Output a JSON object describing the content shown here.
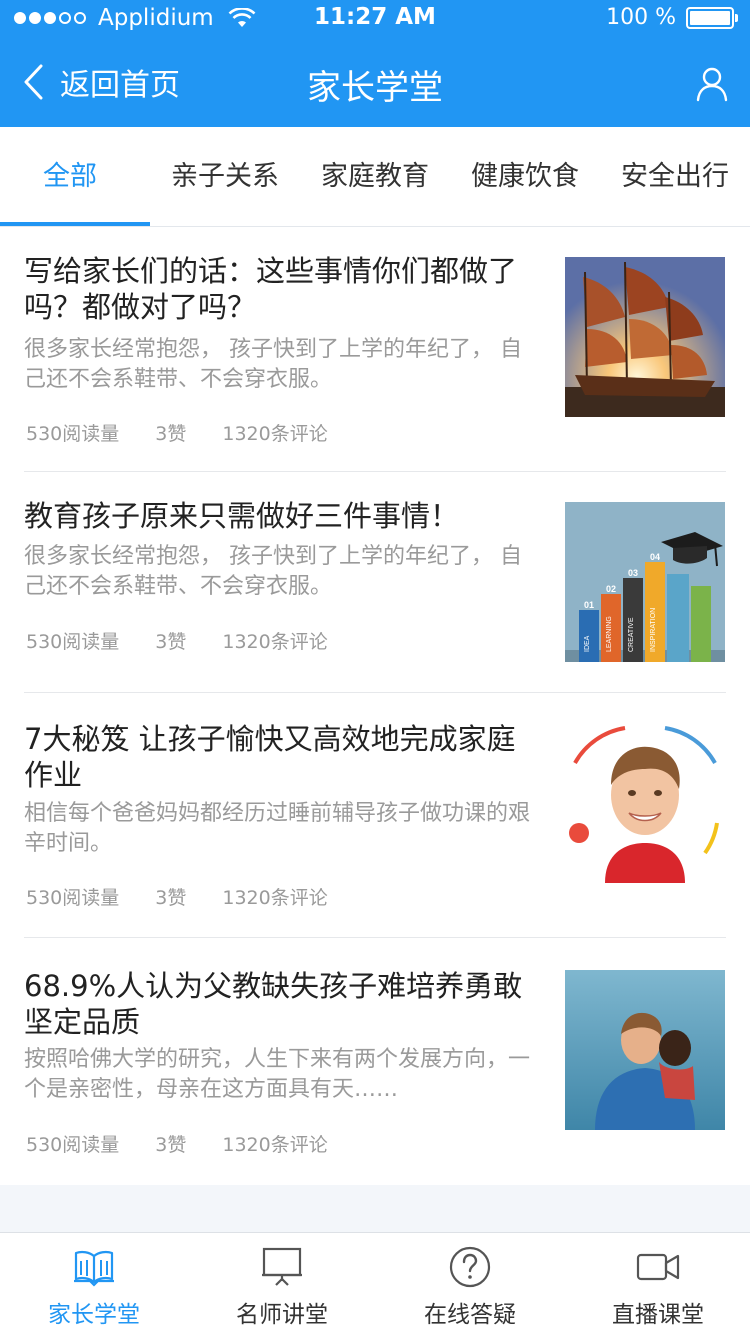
{
  "status_bar": {
    "carrier": "Applidium",
    "time": "11:27 AM",
    "battery": "100 %"
  },
  "navbar": {
    "back_label": "返回首页",
    "title": "家长学堂"
  },
  "tabs": [
    {
      "label": "全部",
      "active": true
    },
    {
      "label": "亲子关系",
      "active": false
    },
    {
      "label": "家庭教育",
      "active": false
    },
    {
      "label": "健康饮食",
      "active": false
    },
    {
      "label": "安全出行",
      "active": false
    }
  ],
  "articles": [
    {
      "title": "写给家长们的话：这些事情你们都做了吗？都做对了吗？",
      "desc": "很多家长经常抱怨， 孩子快到了上学的年纪了， 自己还不会系鞋带、不会穿衣服。",
      "reads": "530阅读量",
      "likes": "3赞",
      "comments": "1320条评论",
      "image": "sailing-ships"
    },
    {
      "title": "教育孩子原来只需做好三件事情！",
      "desc": "很多家长经常抱怨， 孩子快到了上学的年纪了， 自己还不会系鞋带、不会穿衣服。",
      "reads": "530阅读量",
      "likes": "3赞",
      "comments": "1320条评论",
      "image": "books-graduation-cap"
    },
    {
      "title": "7大秘笈 让孩子愉快又高效地完成家庭作业",
      "desc": "相信每个爸爸妈妈都经历过睡前辅导孩子做功课的艰辛时间。",
      "reads": "530阅读量",
      "likes": "3赞",
      "comments": "1320条评论",
      "image": "smiling-boy"
    },
    {
      "title": "68.9%人认为父教缺失孩子难培养勇敢坚定品质",
      "desc": "按照哈佛大学的研究，人生下来有两个发展方向，一个是亲密性，母亲在这方面具有天……",
      "reads": "530阅读量",
      "likes": "3赞",
      "comments": "1320条评论",
      "image": "father-and-child"
    }
  ],
  "book_labels": [
    "01",
    "02",
    "03",
    "04",
    "IDEA",
    "LEARNING",
    "CREATIVE",
    "INSPIRATION"
  ],
  "bottom_tabs": [
    {
      "label": "家长学堂",
      "icon": "book-icon",
      "active": true
    },
    {
      "label": "名师讲堂",
      "icon": "presentation-icon",
      "active": false
    },
    {
      "label": "在线答疑",
      "icon": "question-icon",
      "active": false
    },
    {
      "label": "直播课堂",
      "icon": "video-camera-icon",
      "active": false
    }
  ],
  "colors": {
    "primary": "#2196f3",
    "title_text": "#222222",
    "secondary_text": "#9a9a9a",
    "background": "#f3f6fa"
  }
}
